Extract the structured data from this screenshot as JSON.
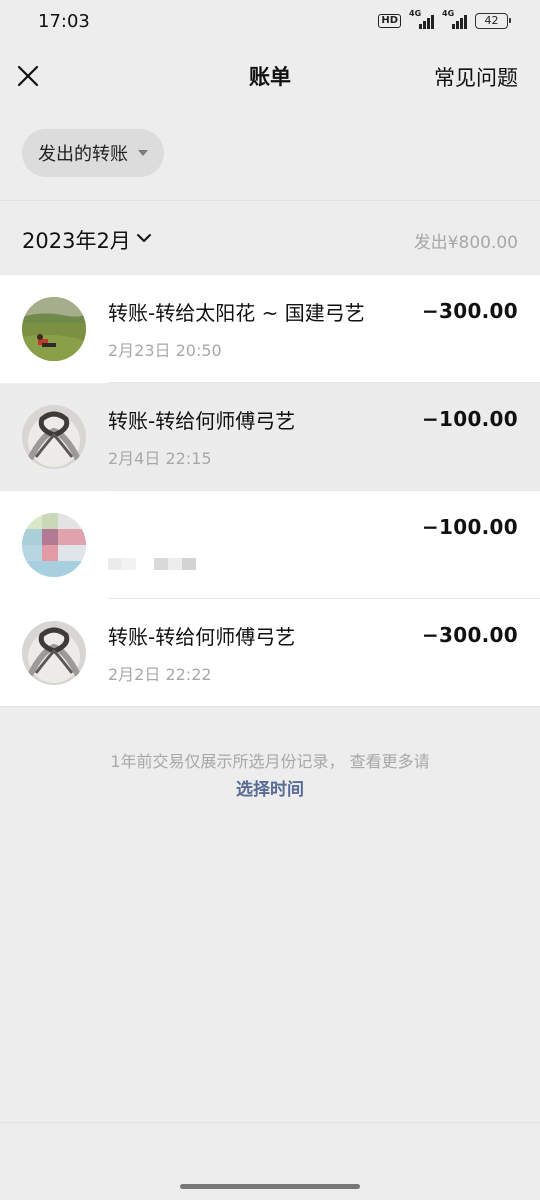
{
  "status_bar": {
    "time": "17:03",
    "hd_label": "HD",
    "network": "4G",
    "battery": "42"
  },
  "nav": {
    "title": "账单",
    "faq": "常见问题",
    "close_icon": "close-icon"
  },
  "filter": {
    "label": "发出的转账"
  },
  "month": {
    "label": "2023年2月",
    "total": "发出¥800.00"
  },
  "transactions": [
    {
      "title": "转账-转给太阳花 ~ 国建弓艺",
      "time": "2月23日 20:50",
      "amount": "−300.00",
      "avatar": "photo-avatar"
    },
    {
      "title": "转账-转给何师傅弓艺",
      "time": "2月4日 22:15",
      "amount": "−100.00",
      "avatar": "knot-avatar"
    },
    {
      "title": "",
      "time": "",
      "amount": "−100.00",
      "avatar": "pixelated-avatar"
    },
    {
      "title": "转账-转给何师傅弓艺",
      "time": "2月2日 22:22",
      "amount": "−300.00",
      "avatar": "knot-avatar"
    }
  ],
  "footer": {
    "note": "1年前交易仅展示所选月份记录， 查看更多请",
    "link": "选择时间"
  },
  "colors": {
    "link": "#576b95",
    "muted": "#a8a8a8",
    "background": "#ededed"
  }
}
